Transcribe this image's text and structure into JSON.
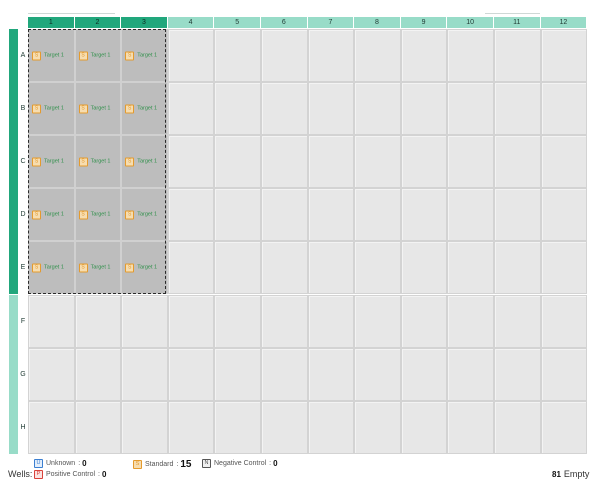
{
  "plate": {
    "columns": [
      "1",
      "2",
      "3",
      "4",
      "5",
      "6",
      "7",
      "8",
      "9",
      "10",
      "11",
      "12"
    ],
    "rows": [
      "A",
      "B",
      "C",
      "D",
      "E",
      "F",
      "G",
      "H"
    ],
    "selected_columns": [
      "1",
      "2",
      "3"
    ],
    "selected_rows": [
      "A",
      "B",
      "C",
      "D",
      "E"
    ],
    "wells": [
      {
        "row": "A",
        "col": "1",
        "type": "S",
        "target": "Target 1"
      },
      {
        "row": "A",
        "col": "2",
        "type": "S",
        "target": "Target 1"
      },
      {
        "row": "A",
        "col": "3",
        "type": "S",
        "target": "Target 1"
      },
      {
        "row": "B",
        "col": "1",
        "type": "S",
        "target": "Target 1"
      },
      {
        "row": "B",
        "col": "2",
        "type": "S",
        "target": "Target 1"
      },
      {
        "row": "B",
        "col": "3",
        "type": "S",
        "target": "Target 1"
      },
      {
        "row": "C",
        "col": "1",
        "type": "S",
        "target": "Target 1"
      },
      {
        "row": "C",
        "col": "2",
        "type": "S",
        "target": "Target 1"
      },
      {
        "row": "C",
        "col": "3",
        "type": "S",
        "target": "Target 1"
      },
      {
        "row": "D",
        "col": "1",
        "type": "S",
        "target": "Target 1"
      },
      {
        "row": "D",
        "col": "2",
        "type": "S",
        "target": "Target 1"
      },
      {
        "row": "D",
        "col": "3",
        "type": "S",
        "target": "Target 1"
      },
      {
        "row": "E",
        "col": "1",
        "type": "S",
        "target": "Target 1"
      },
      {
        "row": "E",
        "col": "2",
        "type": "S",
        "target": "Target 1"
      },
      {
        "row": "E",
        "col": "3",
        "type": "S",
        "target": "Target 1"
      }
    ]
  },
  "footer": {
    "wells_label": "Wells:",
    "unknown": {
      "icon": "U",
      "label": "Unknown",
      "count": "0",
      "color": "#3b7fd1"
    },
    "positive": {
      "icon": "P",
      "label": "Positive Control",
      "count": "0",
      "color": "#d9413a"
    },
    "standard": {
      "icon": "S",
      "label": "Standard",
      "count": "15",
      "color": "#e49a2d"
    },
    "negative": {
      "icon": "N",
      "label": "Negative Control",
      "count": "0",
      "color": "#555555"
    },
    "empty": {
      "count": "81",
      "label": "Empty"
    }
  },
  "colors": {
    "header_selected": "#21a77c",
    "header_unselected": "#98dcc8",
    "well_selected": "#bdbdbd",
    "well_empty": "#e7e7e7",
    "target_text": "#2f8f4a"
  }
}
